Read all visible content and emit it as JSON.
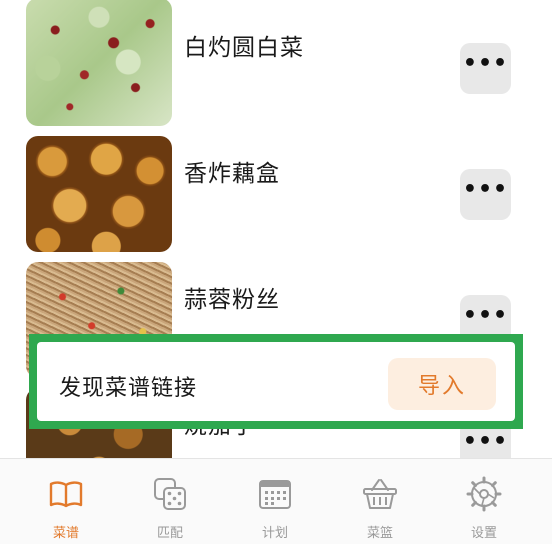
{
  "recipes": [
    {
      "name": "白灼圆白菜",
      "more_label": "•••",
      "thumb": "cabbage"
    },
    {
      "name": "香炸藕盒",
      "more_label": "•••",
      "thumb": "lotus-root"
    },
    {
      "name": "蒜蓉粉丝",
      "more_label": "•••",
      "thumb": "vermicelli"
    },
    {
      "name": "烧茄子",
      "more_label": "•••",
      "thumb": "eggplant"
    }
  ],
  "popup": {
    "label": "发现菜谱链接",
    "import_label": "导入"
  },
  "tabbar": {
    "items": [
      {
        "label": "菜谱",
        "icon": "book-icon",
        "active": true
      },
      {
        "label": "匹配",
        "icon": "dice-icon",
        "active": false
      },
      {
        "label": "计划",
        "icon": "calendar-icon",
        "active": false
      },
      {
        "label": "菜篮",
        "icon": "basket-icon",
        "active": false
      },
      {
        "label": "设置",
        "icon": "gear-icon",
        "active": false
      }
    ]
  },
  "colors": {
    "accent": "#e27a2c",
    "popup_border": "#2fa84f",
    "import_bg": "#fdeee0",
    "more_bg": "#e8e8e8",
    "tab_inactive": "#9a9a9a"
  }
}
